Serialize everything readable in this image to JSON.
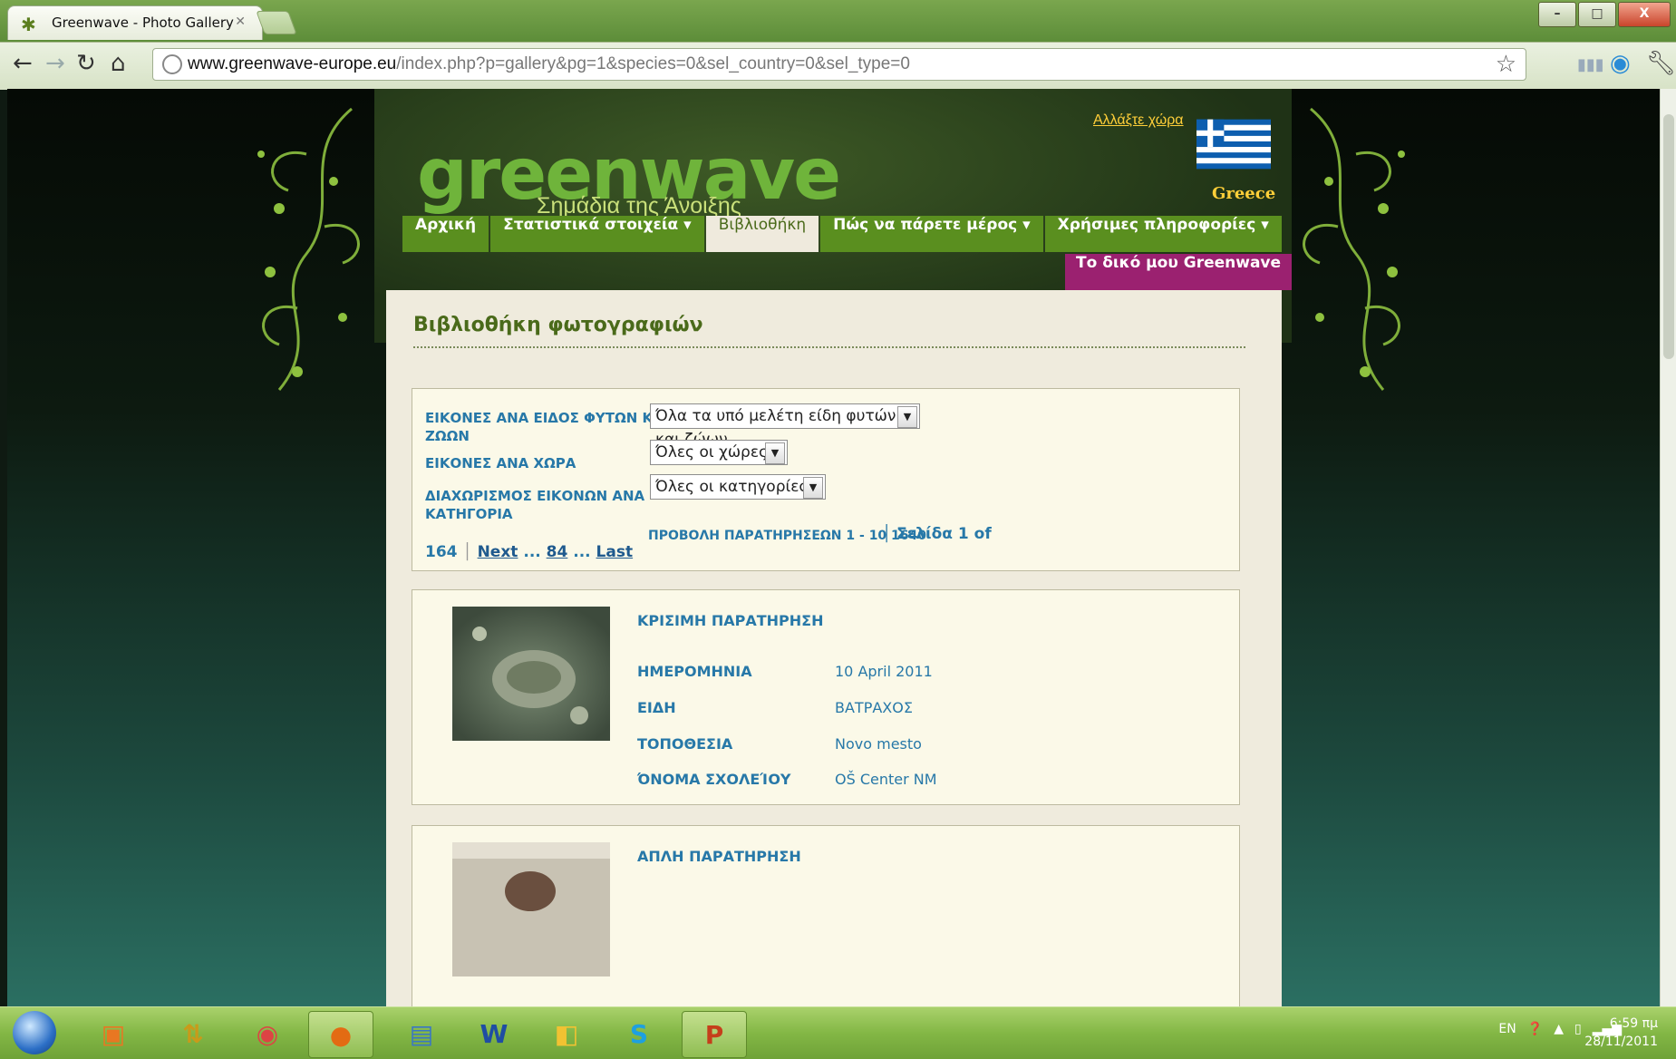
{
  "browser": {
    "tab_title": "Greenwave - Photo Gallery",
    "url_domain": "www.greenwave-europe.eu",
    "url_path": "/index.php?p=gallery&pg=1&species=0&sel_country=0&sel_type=0",
    "min_label": "–",
    "max_label": "□",
    "close_label": "X"
  },
  "header": {
    "logo_text": "greenwave",
    "tagline": "Σημάδια της Άνοιξης",
    "change_country": "Αλλάξτε χώρα",
    "country": "Greece"
  },
  "menu": [
    {
      "label": "Αρχική"
    },
    {
      "label": "Στατιστικά στοιχεία ▾"
    },
    {
      "label": "Βιβλιοθήκη"
    },
    {
      "label": "Πώς να πάρετε μέρος ▾"
    },
    {
      "label": "Χρήσιμες πληροφορίες ▾"
    }
  ],
  "my_greenwave": "Το δικό μου Greenwave",
  "content": {
    "title": "Βιβλιοθήκη φωτογραφιών",
    "filters": {
      "species_label_1": "ΕΙΚΟΝΕΣ ΑΝΑ ΕΙΔΟΣ ΦΥΤΩΝ ΚΑΙ",
      "species_label_2": "ΖΩΩΝ",
      "species_value": "Όλα τα υπό μελέτη είδη φυτών και ζώων",
      "country_label": "ΕΙΚΟΝΕΣ ΑΝΑ ΧΩΡΑ",
      "country_value": "Όλες οι χώρες",
      "category_label_1": "ΔΙΑΧΩΡΙΣΜΟΣ ΕΙΚΟΝΩΝ ΑΝΑ",
      "category_label_2": "ΚΑΤΗΓΟΡΙΑ",
      "category_value": "Όλες οι κατηγορίες"
    },
    "pagination": {
      "showing": "ΠΡΟΒΟΛΗ ΠΑΡΑΤΗΡΗΣΕΩΝ 1 - 10 1640",
      "page_of": "│ Σελίδα 1 of",
      "total": "164",
      "next": "Next",
      "ellipsis1": " ... ",
      "mid_page": "84",
      "ellipsis2": " ... ",
      "last": "Last"
    },
    "cards": [
      {
        "title": "ΚΡΙΣΙΜΗ ΠΑΡΑΤΗΡΗΣΗ",
        "date_label": "ΗΜΕΡΟΜΗΝΙΑ",
        "date": "10 April 2011",
        "species_label": "ΕΙΔΗ",
        "species": "ΒΑΤΡΑΧΟΣ",
        "location_label": "ΤΟΠΟΘΕΣΙΑ",
        "location": "Novo mesto",
        "school_label": "ΌΝΟΜΑ ΣΧΟΛΕΊΟΥ",
        "school": "OŠ Center NM"
      },
      {
        "title": "ΑΠΛΗ ΠΑΡΑΤΗΡΗΣΗ"
      }
    ]
  },
  "taskbar": {
    "lang": "EN",
    "time": "6:59 πμ",
    "date": "28/11/2011"
  }
}
